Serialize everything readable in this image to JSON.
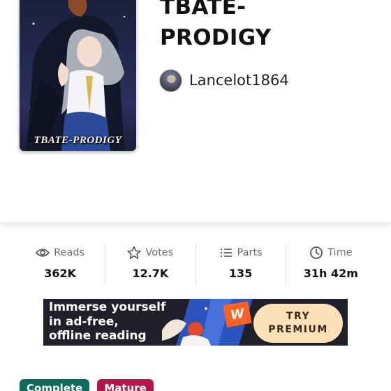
{
  "story": {
    "title": "TBATE-\nPRODIGY",
    "cover_text": "TBATE-PRODIGY",
    "author": "Lancelot1864"
  },
  "stats": [
    {
      "icon": "eye-icon",
      "label": "Reads",
      "value": "362K"
    },
    {
      "icon": "star-icon",
      "label": "Votes",
      "value": "12.7K"
    },
    {
      "icon": "list-icon",
      "label": "Parts",
      "value": "135"
    },
    {
      "icon": "clock-icon",
      "label": "Time",
      "value": "31h 42m"
    }
  ],
  "ad": {
    "headline": "Immerse yourself\nin ad-free,\noffline reading",
    "logo": "W",
    "cta": "TRY\nPREMIUM"
  },
  "tags": [
    {
      "label": "Complete",
      "color": "#0f6b5c"
    },
    {
      "label": "Mature",
      "color": "#b3174a"
    }
  ],
  "colors": {
    "text": "#121212",
    "muted": "#6f6f6f",
    "ad_background": "#20202c",
    "cta_background": "#fbe0b8"
  }
}
